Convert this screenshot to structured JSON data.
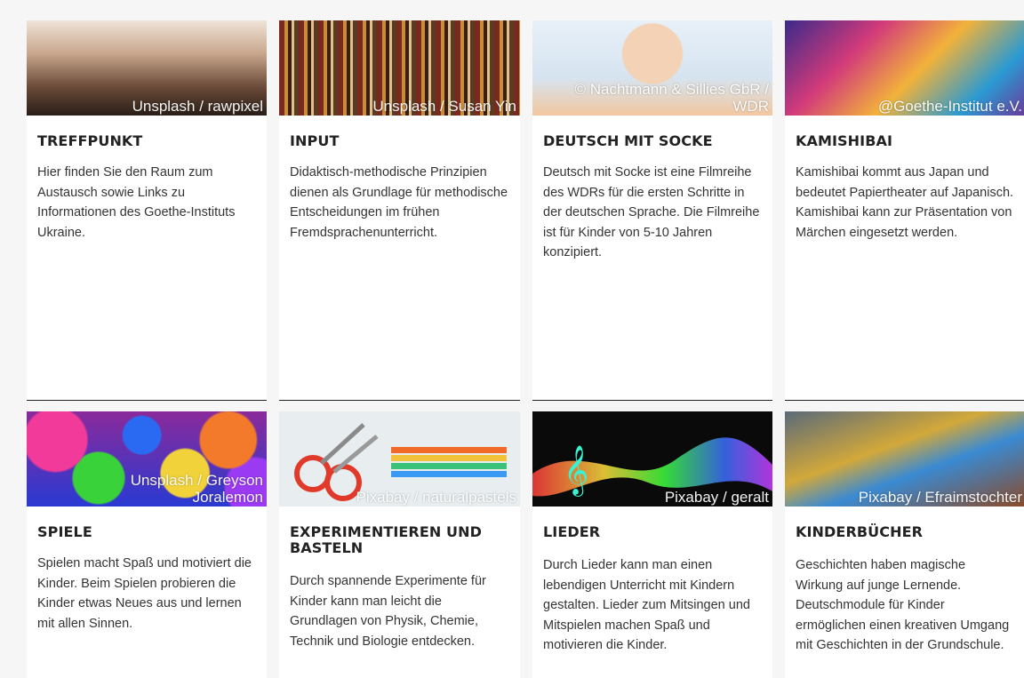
{
  "cards": [
    {
      "title": "TREFFPUNKT",
      "credit": "Unsplash / rawpixel",
      "desc": "Hier finden Sie den Raum zum Austausch sowie Links zu Informationen des Goethe-Instituts Ukraine."
    },
    {
      "title": "INPUT",
      "credit": "Unsplash / Susan Yin",
      "desc": "Didaktisch-methodische Prinzipien dienen als Grundlage für methodische Entscheidungen im frühen Fremdsprachenunterricht."
    },
    {
      "title": "DEUTSCH MIT SOCKE",
      "credit": "© Nachtmann & Sillies GbR / WDR",
      "desc": "Deutsch mit Socke ist eine Filmreihe des WDRs für die ersten Schritte in der deutschen Sprache. Die Filmreihe ist für Kinder von 5-10 Jahren konzipiert."
    },
    {
      "title": "KAMISHIBAI",
      "credit": "@Goethe-Institut e.V.",
      "desc": "Kamishibai kommt aus Japan und bedeutet Papiertheater auf Japanisch. Kamishibai kann zur Präsentation von Märchen eingesetzt werden."
    },
    {
      "title": "SPIELE",
      "credit": "Unsplash / Greyson Joralemon",
      "desc": "Spielen macht Spaß und motiviert die Kinder. Beim Spielen probieren die Kinder etwas Neues aus und lernen mit allen Sinnen."
    },
    {
      "title": "EXPERIMENTIEREN UND BASTELN",
      "credit": "Pixabay / naturalpastels",
      "desc": "Durch spannende Experimente für Kinder kann man leicht die Grundlagen von Physik, Chemie, Technik und Biologie entdecken."
    },
    {
      "title": "LIEDER",
      "credit": "Pixabay / geralt",
      "desc": "Durch Lieder kann man einen lebendigen Unterricht mit Kindern gestalten. Lieder zum Mitsingen und Mitspielen machen Spaß und motivieren die Kinder."
    },
    {
      "title": "KINDERBÜCHER",
      "credit": "Pixabay / Efraimstochter",
      "desc": "Geschichten haben magische Wirkung auf junge Lernende. Deutschmodule für Kinder ermöglichen einen kreativen Umgang mit Geschichten in der Grundschule."
    }
  ],
  "images": [
    "hands-photo",
    "library-photo",
    "deutsch-mit-socke-photo",
    "kamishibai-drawing",
    "colorful-balls-photo",
    "scissors-pencils-photo",
    "music-waves-image",
    "childrens-books-photo"
  ]
}
